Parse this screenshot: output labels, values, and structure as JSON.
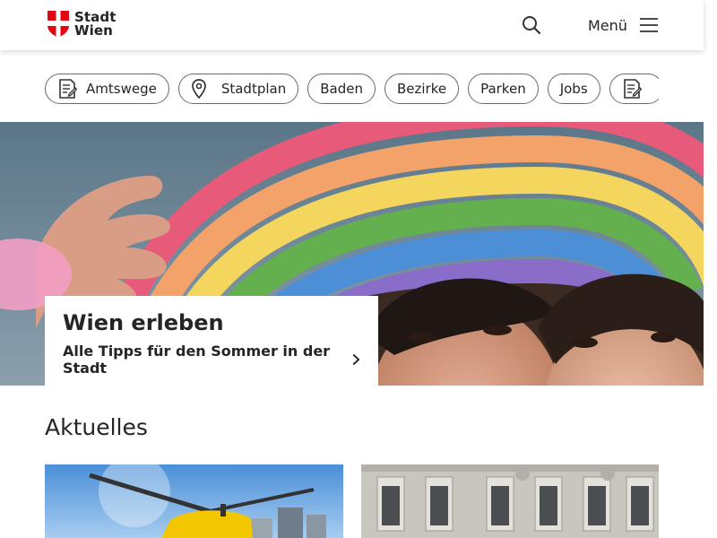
{
  "header": {
    "logo_line1": "Stadt",
    "logo_line2": "Wien",
    "menu_label": "Menü"
  },
  "chips": [
    {
      "label": "Amtswege",
      "icon": "document-icon"
    },
    {
      "label": "Stadtplan",
      "icon": "location-pin-icon"
    },
    {
      "label": "Baden",
      "icon": null
    },
    {
      "label": "Bezirke",
      "icon": null
    },
    {
      "label": "Parken",
      "icon": null
    },
    {
      "label": "Jobs",
      "icon": null
    },
    {
      "label": "",
      "icon": "document-icon"
    }
  ],
  "hero": {
    "title": "Wien erleben",
    "link": "Alle Tipps für den Sommer in der Stadt"
  },
  "aktuelles": {
    "title": "Aktuelles"
  },
  "colors": {
    "brand_red": "#e30613",
    "text": "#252525",
    "chip_border": "#6b6b6b"
  }
}
